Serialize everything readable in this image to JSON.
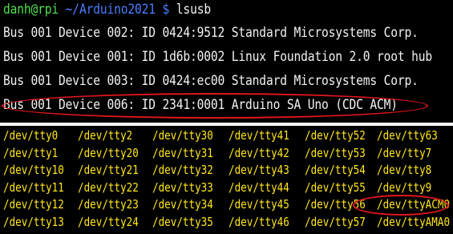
{
  "prompt": {
    "user": "danh@rpi",
    "path": "~/Arduino2021",
    "symbol": "$",
    "command": "lsusb"
  },
  "lsusb_lines": [
    "Bus 001 Device 002: ID 0424:9512 Standard Microsystems Corp.",
    "Bus 001 Device 001: ID 1d6b:0002 Linux Foundation 2.0 root hub",
    "Bus 001 Device 003: ID 0424:ec00 Standard Microsystems Corp.",
    "Bus 001 Device 006: ID 2341:0001 Arduino SA Uno (CDC ACM)"
  ],
  "dev_columns": [
    [
      "/dev/tty0",
      "/dev/tty1",
      "/dev/tty10",
      "/dev/tty11",
      "/dev/tty12",
      "/dev/tty13"
    ],
    [
      "/dev/tty2",
      "/dev/tty20",
      "/dev/tty21",
      "/dev/tty22",
      "/dev/tty23",
      "/dev/tty24"
    ],
    [
      "/dev/tty30",
      "/dev/tty31",
      "/dev/tty32",
      "/dev/tty33",
      "/dev/tty34",
      "/dev/tty35"
    ],
    [
      "/dev/tty41",
      "/dev/tty42",
      "/dev/tty43",
      "/dev/tty44",
      "/dev/tty45",
      "/dev/tty46"
    ],
    [
      "/dev/tty52",
      "/dev/tty53",
      "/dev/tty54",
      "/dev/tty55",
      "/dev/tty56",
      "/dev/tty57"
    ],
    [
      "/dev/tty63",
      "/dev/tty7",
      "/dev/tty8",
      "/dev/tty9",
      "/dev/ttyACM0",
      "/dev/ttyAMA0"
    ]
  ],
  "colors": {
    "background": "#000000",
    "text": "#f2f2f2",
    "prompt_user": "#4ee04e",
    "prompt_path": "#4a7dff",
    "device_text": "#ffe61a",
    "highlight": "#e0161c"
  }
}
